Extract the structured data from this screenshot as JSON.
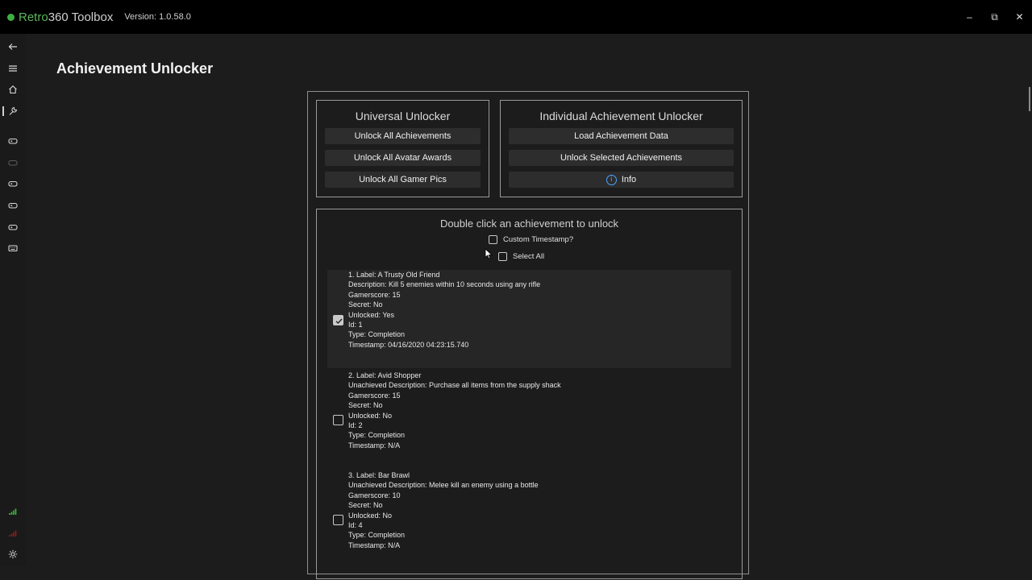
{
  "app": {
    "name_prefix": "Retro",
    "name_suffix": "360 Toolbox",
    "version": "Version: 1.0.58.0"
  },
  "window_controls": {
    "minimize": "–",
    "maximize": "⧉",
    "close": "✕"
  },
  "page": {
    "title": "Achievement Unlocker"
  },
  "universal": {
    "title": "Universal Unlocker",
    "unlock_all_achievements": "Unlock All Achievements",
    "unlock_all_avatar_awards": "Unlock All Avatar Awards",
    "unlock_all_gamer_pics": "Unlock All Gamer Pics"
  },
  "individual": {
    "title": "Individual Achievement Unlocker",
    "load_data": "Load Achievement Data",
    "unlock_selected": "Unlock Selected Achievements",
    "info": "Info",
    "info_glyph": "i"
  },
  "list": {
    "hint": "Double click an achievement to unlock",
    "custom_timestamp": "Custom Timestamp?",
    "select_all": "Select All"
  },
  "achievements": [
    {
      "checked": true,
      "lines": [
        "1. Label: A Trusty Old Friend",
        "Description: Kill 5 enemies within 10 seconds using any rifle",
        "Gamerscore: 15",
        "Secret: No",
        "Unlocked: Yes",
        "Id: 1",
        "Type: Completion",
        "Timestamp: 04/16/2020 04:23:15.740"
      ]
    },
    {
      "checked": false,
      "lines": [
        "2. Label: Avid Shopper",
        "Unachieved Description: Purchase all items from the supply shack",
        "Gamerscore: 15",
        "Secret: No",
        "Unlocked: No",
        "Id: 2",
        "Type: Completion",
        "Timestamp: N/A"
      ]
    },
    {
      "checked": false,
      "lines": [
        "3. Label: Bar Brawl",
        "Unachieved Description: Melee kill an enemy using a bottle",
        "Gamerscore: 10",
        "Secret: No",
        "Unlocked: No",
        "Id: 4",
        "Type: Completion",
        "Timestamp: N/A"
      ]
    }
  ],
  "colors": {
    "brand_green": "#5bb55b",
    "status_good": "#3fbf3f",
    "status_bad": "#8b1f1f",
    "info_blue": "#4aa3ff"
  },
  "sidebar_icons": [
    "back-arrow-icon",
    "hamburger-menu-icon",
    "home-icon",
    "wrench-icon",
    "gamepad-icon",
    "gamepad-icon",
    "gamepad-icon",
    "gamepad-icon",
    "gamepad-icon",
    "keyboard-icon",
    "signal-bars-icon",
    "signal-bars-icon",
    "gear-icon"
  ]
}
